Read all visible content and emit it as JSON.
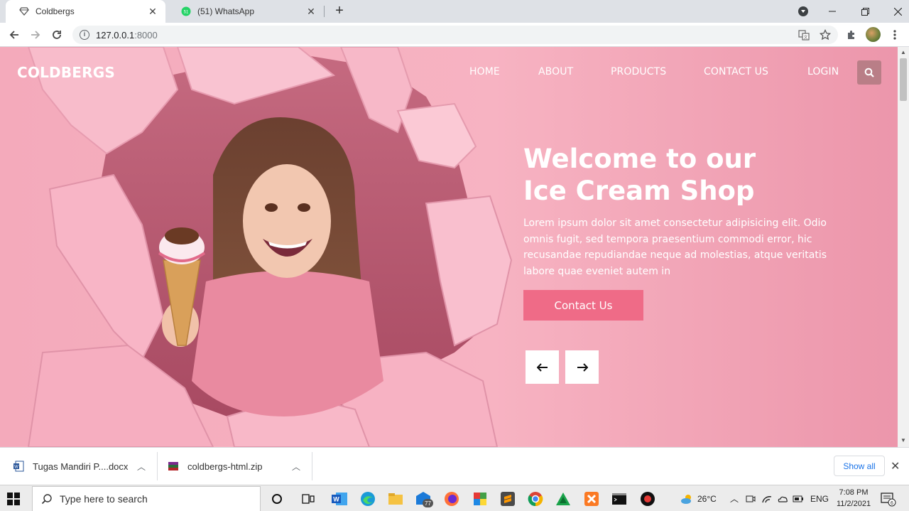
{
  "browser": {
    "tabs": [
      {
        "title": "Coldbergs",
        "active": true,
        "icon": "diamond-favicon"
      },
      {
        "title": "(51) WhatsApp",
        "active": false,
        "icon": "whatsapp-favicon"
      }
    ],
    "new_tab": "+",
    "url_host": "127.0.0.1",
    "url_port": ":8000"
  },
  "site": {
    "logo": "COLDBERGS",
    "nav": [
      "HOME",
      "ABOUT",
      "PRODUCTS",
      "CONTACT US",
      "LOGIN"
    ],
    "hero": {
      "title_line1": "Welcome to our",
      "title_line2": "Ice Cream Shop",
      "text": "Lorem ipsum dolor sit amet consectetur adipisicing elit. Odio omnis fugit, sed tempora praesentium commodi error, hic recusandae repudiandae neque ad molestias, atque veritatis labore quae eveniet autem in",
      "cta": "Contact Us"
    },
    "colors": {
      "background": "#f4a6b8",
      "accent": "#ef6b87",
      "search_button": "#b97e87"
    }
  },
  "downloads": {
    "items": [
      {
        "name": "Tugas  Mandiri P....docx",
        "icon": "word-doc-icon"
      },
      {
        "name": "coldbergs-html.zip",
        "icon": "zip-archive-icon"
      }
    ],
    "show_all": "Show all"
  },
  "taskbar": {
    "search_placeholder": "Type here to search",
    "mail_badge": "77",
    "weather": "26°C",
    "language": "ENG",
    "time": "7:08 PM",
    "date": "11/2/2021",
    "notifications": "6"
  }
}
